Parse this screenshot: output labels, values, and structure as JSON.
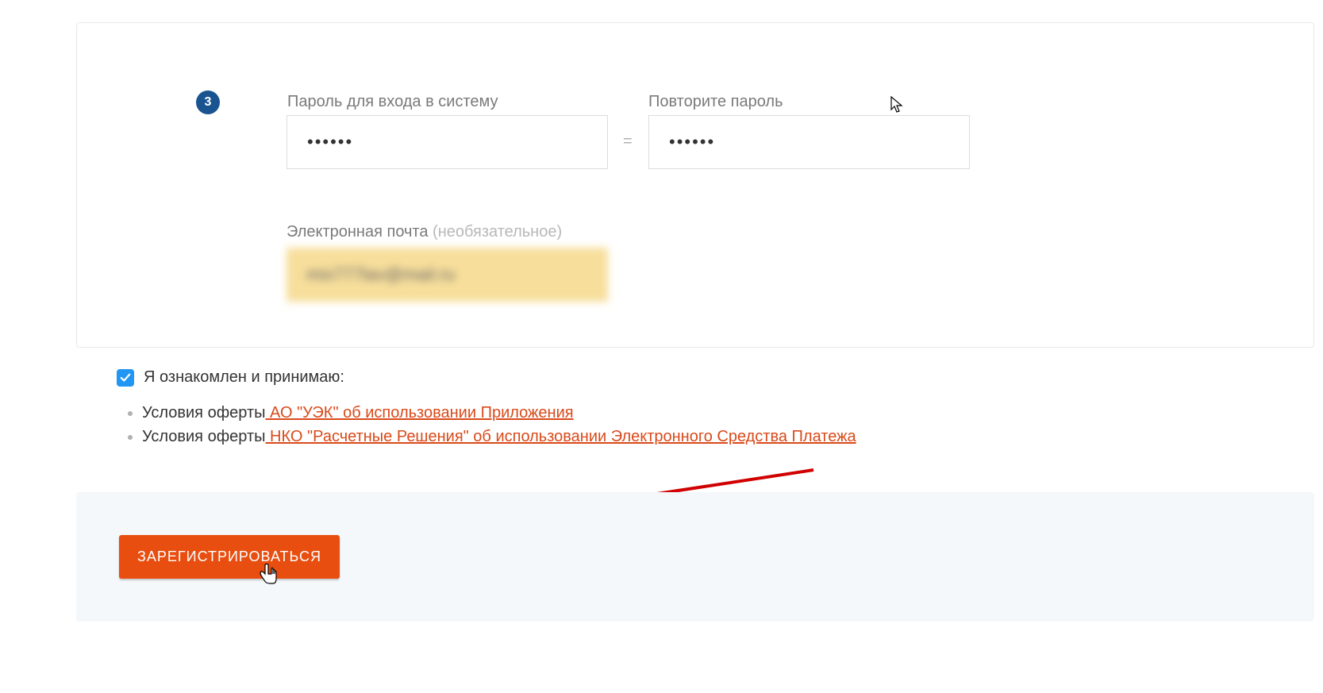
{
  "step": {
    "number": "3"
  },
  "fields": {
    "password_label": "Пароль для входа в систему",
    "repeat_label": "Повторите пароль",
    "password_value": "••••••",
    "repeat_value": "••••••",
    "equals": "=",
    "email_label": "Электронная почта",
    "email_optional": "(необязательное)",
    "email_value": "mix777lav@mail.ru"
  },
  "consent": {
    "intro": "Я ознакомлен и принимаю:",
    "terms_prefix": "Условия оферты",
    "link1": " АО \"УЭК\" об использовании Приложения",
    "link2": " НКО \"Расчетные Решения\" об использовании Электронного Средства Платежа"
  },
  "actions": {
    "register": "ЗАРЕГИСТРИРОВАТЬСЯ"
  }
}
